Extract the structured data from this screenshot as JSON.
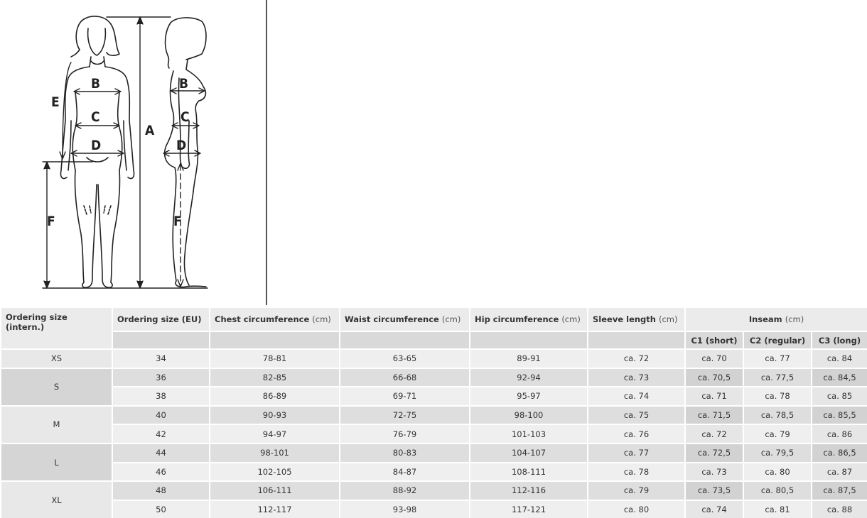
{
  "figure": {
    "labels": {
      "a": "A",
      "b": "B",
      "c": "C",
      "d": "D",
      "e": "E",
      "f": "F"
    }
  },
  "table": {
    "headers": {
      "intern": {
        "bold": "Ordering size (intern.)",
        "unit": ""
      },
      "eu": {
        "bold": "Ordering size (EU)",
        "unit": ""
      },
      "chest": {
        "bold": "Chest circumference",
        "unit": "(cm)"
      },
      "waist": {
        "bold": "Waist circumference",
        "unit": "(cm)"
      },
      "hip": {
        "bold": "Hip circumference",
        "unit": "(cm)"
      },
      "sleeve": {
        "bold": "Sleeve length",
        "unit": "(cm)"
      },
      "inseam": {
        "bold": "Inseam",
        "unit": "(cm)"
      }
    },
    "inseam_sub": [
      "C1 (short)",
      "C2 (regular)",
      "C3 (long)"
    ],
    "groups": [
      {
        "intern": "XS",
        "rows": [
          {
            "eu": "34",
            "chest": "78-81",
            "waist": "63-65",
            "hip": "89-91",
            "sleeve": "ca. 72",
            "c1": "ca. 70",
            "c2": "ca. 77",
            "c3": "ca. 84"
          }
        ]
      },
      {
        "intern": "S",
        "rows": [
          {
            "eu": "36",
            "chest": "82-85",
            "waist": "66-68",
            "hip": "92-94",
            "sleeve": "ca. 73",
            "c1": "ca. 70,5",
            "c2": "ca. 77,5",
            "c3": "ca. 84,5"
          },
          {
            "eu": "38",
            "chest": "86-89",
            "waist": "69-71",
            "hip": "95-97",
            "sleeve": "ca. 74",
            "c1": "ca. 71",
            "c2": "ca. 78",
            "c3": "ca. 85"
          }
        ]
      },
      {
        "intern": "M",
        "rows": [
          {
            "eu": "40",
            "chest": "90-93",
            "waist": "72-75",
            "hip": "98-100",
            "sleeve": "ca. 75",
            "c1": "ca. 71,5",
            "c2": "ca. 78,5",
            "c3": "ca. 85,5"
          },
          {
            "eu": "42",
            "chest": "94-97",
            "waist": "76-79",
            "hip": "101-103",
            "sleeve": "ca. 76",
            "c1": "ca. 72",
            "c2": "ca. 79",
            "c3": "ca. 86"
          }
        ]
      },
      {
        "intern": "L",
        "rows": [
          {
            "eu": "44",
            "chest": "98-101",
            "waist": "80-83",
            "hip": "104-107",
            "sleeve": "ca. 77",
            "c1": "ca. 72,5",
            "c2": "ca. 79,5",
            "c3": "ca. 86,5"
          },
          {
            "eu": "46",
            "chest": "102-105",
            "waist": "84-87",
            "hip": "108-111",
            "sleeve": "ca. 78",
            "c1": "ca. 73",
            "c2": "ca. 80",
            "c3": "ca. 87"
          }
        ]
      },
      {
        "intern": "XL",
        "rows": [
          {
            "eu": "48",
            "chest": "106-111",
            "waist": "88-92",
            "hip": "112-116",
            "sleeve": "ca. 79",
            "c1": "ca. 73,5",
            "c2": "ca. 80,5",
            "c3": "ca. 87,5"
          },
          {
            "eu": "50",
            "chest": "112-117",
            "waist": "93-98",
            "hip": "117-121",
            "sleeve": "ca. 80",
            "c1": "ca. 74",
            "c2": "ca. 81",
            "c3": "ca. 88"
          }
        ]
      }
    ]
  }
}
